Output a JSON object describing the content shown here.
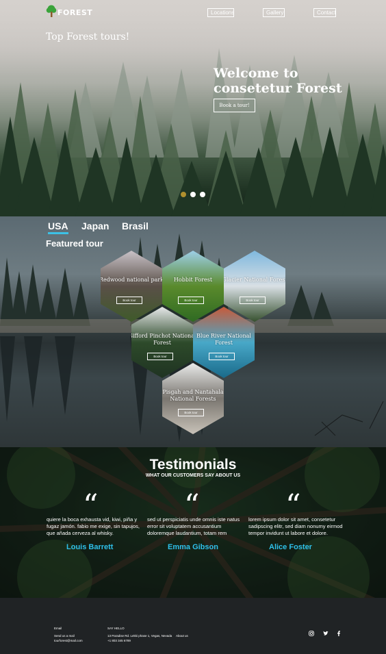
{
  "brand": {
    "name": "FOREST"
  },
  "nav": [
    {
      "label": "Locations"
    },
    {
      "label": "Gallery"
    },
    {
      "label": "Contact"
    }
  ],
  "hero": {
    "tagline": "Top Forest tours!",
    "title": "Welcome to consetetur Forest",
    "button": "Book a tour!",
    "slides": {
      "count": 3,
      "active": 1
    }
  },
  "featured": {
    "tabs": [
      {
        "label": "USA",
        "active": true
      },
      {
        "label": "Japan",
        "active": false
      },
      {
        "label": "Brasil",
        "active": false
      }
    ],
    "title": "Featured tour",
    "tours": [
      {
        "name": "Redwood national park",
        "button": "Book tour",
        "colors": [
          "#c9c2c8",
          "#5a5048",
          "#3f5a2a"
        ]
      },
      {
        "name": "Hobbit Forest",
        "button": "Book tour",
        "colors": [
          "#9ecfe8",
          "#5a8a2c",
          "#2f6a22"
        ]
      },
      {
        "name": "Glacier National Forest",
        "button": "Book tour",
        "colors": [
          "#7fb8de",
          "#d8dfe4",
          "#36502e"
        ]
      },
      {
        "name": "Gifford Pinchot National Forest",
        "button": "Book tour",
        "colors": [
          "#e7e9ea",
          "#2d4a2a",
          "#1f3322"
        ]
      },
      {
        "name": "Blue River National Forest",
        "button": "Book tour",
        "colors": [
          "#c85a3a",
          "#48a8c8",
          "#1a6a8a"
        ]
      },
      {
        "name": "Pisgah and Nantahala National Forests",
        "button": "Book tour",
        "colors": [
          "#eaebea",
          "#7a7670",
          "#c8c2b8"
        ]
      }
    ]
  },
  "testimonials": {
    "title": "Testimonials",
    "subtitle": "WHAT OUR CUSTOMERS SAY ABOUT US",
    "items": [
      {
        "quote": "quiere la boca exhausta vid, kiwi, piña y fugaz jamón. fabio me exige, sin tapujos, que añada cerveza al whisky.",
        "name": "Louis Barrett"
      },
      {
        "quote": "sed ut perspiciatis unde omnis iste natus error sit voluptatem accusantium doloremque laudantium, totam rem",
        "name": "Emma Gibson"
      },
      {
        "quote": "lorem ipsum dolor sit amet, consetetur sadipscing elitr, sed diam nonumy eirmod tempor invidunt ut labore et dolore.",
        "name": "Alice Foster"
      }
    ],
    "accent": "#2ec0ea"
  },
  "footer": {
    "email_label": "Email",
    "send_label": "Send us a mail",
    "email": "tourforest@mail.com",
    "hello_label": "SAY HELLO",
    "address": "13 Paradise Rd. Lekki phase 1, Vegas, Nevada",
    "phone": "+1 803 345 6789",
    "about": "About us",
    "social": [
      "instagram-icon",
      "twitter-icon",
      "facebook-icon"
    ]
  }
}
